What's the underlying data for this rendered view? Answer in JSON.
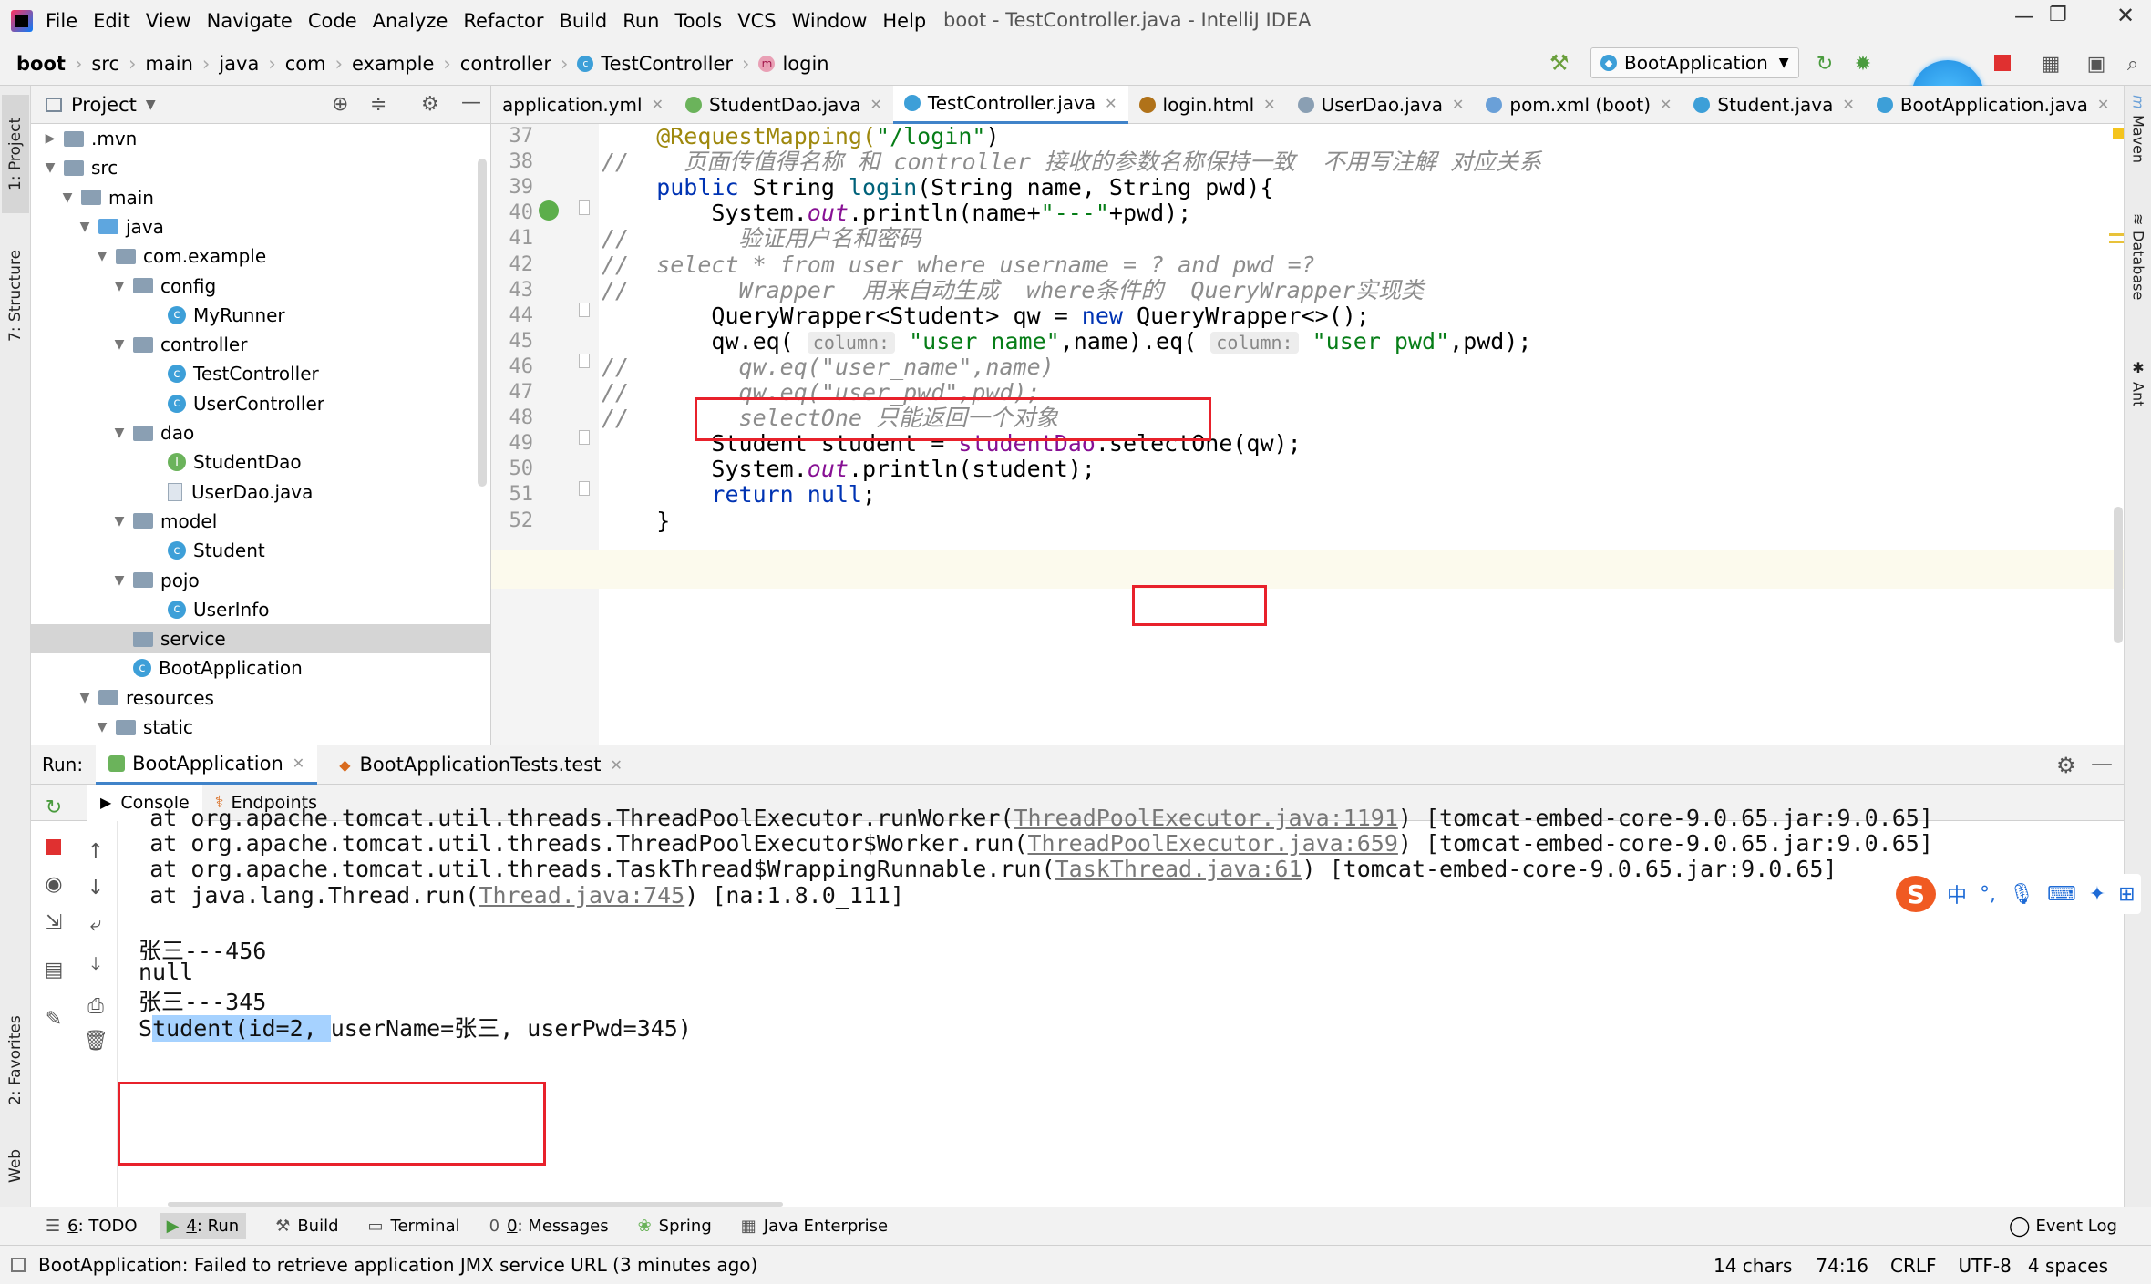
{
  "menubar": {
    "items": [
      "File",
      "Edit",
      "View",
      "Navigate",
      "Code",
      "Analyze",
      "Refactor",
      "Build",
      "Run",
      "Tools",
      "VCS",
      "Window",
      "Help"
    ],
    "window_title": "boot - TestController.java - IntelliJ IDEA"
  },
  "navbar": {
    "crumbs": [
      "boot",
      "src",
      "main",
      "java",
      "com",
      "example",
      "controller",
      "TestController",
      "login"
    ],
    "run_config": "BootApplication"
  },
  "project": {
    "title": "Project",
    "tree": [
      {
        "label": ".mvn",
        "arrow": "▶",
        "kind": "folder"
      },
      {
        "label": "src",
        "arrow": "▼",
        "kind": "folder"
      },
      {
        "label": "main",
        "arrow": "▼",
        "kind": "folder"
      },
      {
        "label": "java",
        "arrow": "▼",
        "kind": "folder-blue"
      },
      {
        "label": "com.example",
        "arrow": "▼",
        "kind": "folder"
      },
      {
        "label": "config",
        "arrow": "▼",
        "kind": "folder"
      },
      {
        "label": "MyRunner",
        "arrow": "",
        "kind": "class"
      },
      {
        "label": "controller",
        "arrow": "▼",
        "kind": "folder"
      },
      {
        "label": "TestController",
        "arrow": "",
        "kind": "class"
      },
      {
        "label": "UserController",
        "arrow": "",
        "kind": "class"
      },
      {
        "label": "dao",
        "arrow": "▼",
        "kind": "folder"
      },
      {
        "label": "StudentDao",
        "arrow": "",
        "kind": "interface"
      },
      {
        "label": "UserDao.java",
        "arrow": "",
        "kind": "file"
      },
      {
        "label": "model",
        "arrow": "▼",
        "kind": "folder"
      },
      {
        "label": "Student",
        "arrow": "",
        "kind": "class"
      },
      {
        "label": "pojo",
        "arrow": "▼",
        "kind": "folder"
      },
      {
        "label": "UserInfo",
        "arrow": "",
        "kind": "class"
      },
      {
        "label": "service",
        "arrow": "",
        "kind": "folder"
      },
      {
        "label": "BootApplication",
        "arrow": "",
        "kind": "class"
      },
      {
        "label": "resources",
        "arrow": "▼",
        "kind": "folder"
      },
      {
        "label": "static",
        "arrow": "▼",
        "kind": "folder"
      }
    ]
  },
  "tabs": [
    {
      "label": "application.yml",
      "icon": "yml-icon",
      "color": "#8a8a8a"
    },
    {
      "label": "StudentDao.java",
      "icon": "interface-icon",
      "color": "#6bb35b"
    },
    {
      "label": "TestController.java",
      "icon": "class-icon",
      "color": "#3d9fd8",
      "active": true
    },
    {
      "label": "login.html",
      "icon": "html-icon",
      "color": "#b07219"
    },
    {
      "label": "UserDao.java",
      "icon": "file-icon",
      "color": "#8a9fb3"
    },
    {
      "label": "pom.xml (boot)",
      "icon": "maven-icon",
      "color": "#6aa0d8"
    },
    {
      "label": "Student.java",
      "icon": "class-icon",
      "color": "#3d9fd8"
    },
    {
      "label": "BootApplication.java",
      "icon": "class-icon",
      "color": "#3d9fd8"
    }
  ],
  "editor": {
    "lines": [
      {
        "n": "37",
        "parts": [
          {
            "c": "ann",
            "t": "    @RequestMapping("
          },
          {
            "c": "str",
            "t": "\"/login\""
          },
          {
            "c": "",
            "t": ")"
          }
        ]
      },
      {
        "n": "38",
        "parts": [
          {
            "c": "cm",
            "t": "//    页面传值得名称 和 controller 接收的参数名称保持一致  不用写注解 对应关系"
          }
        ]
      },
      {
        "n": "39",
        "parts": [
          {
            "c": "kw",
            "t": "    public "
          },
          {
            "c": "",
            "t": "String "
          },
          {
            "c": "mth",
            "t": "login"
          },
          {
            "c": "",
            "t": "(String name, String pwd){"
          }
        ]
      },
      {
        "n": "40",
        "parts": [
          {
            "c": "",
            "t": "        System."
          },
          {
            "c": "fld",
            "t": "out"
          },
          {
            "c": "",
            "t": ".println(name+"
          },
          {
            "c": "str",
            "t": "\"---\""
          },
          {
            "c": "",
            "t": "+pwd);"
          }
        ]
      },
      {
        "n": "41",
        "parts": [
          {
            "c": "cm",
            "t": "//        验证用户名和密码"
          }
        ]
      },
      {
        "n": "42",
        "parts": [
          {
            "c": "cm",
            "t": "//  select * from user where username = ? and pwd =?"
          }
        ]
      },
      {
        "n": "43",
        "parts": [
          {
            "c": "cm",
            "t": "//        Wrapper  用来自动生成  where条件的  QueryWrapper实现类"
          }
        ]
      },
      {
        "n": "44",
        "parts": [
          {
            "c": "",
            "t": "        QueryWrapper<Student> qw = "
          },
          {
            "c": "kw",
            "t": "new "
          },
          {
            "c": "",
            "t": "QueryWrapper<>();"
          }
        ]
      },
      {
        "n": "45",
        "parts": [
          {
            "c": "",
            "t": "        qw.eq( "
          },
          {
            "c": "hint",
            "t": "column:"
          },
          {
            "c": "str",
            "t": " \"user_name\""
          },
          {
            "c": "",
            "t": ",name).eq( "
          },
          {
            "c": "hint",
            "t": "column:"
          },
          {
            "c": "str",
            "t": " \"user_pwd\""
          },
          {
            "c": "",
            "t": ",pwd);"
          }
        ]
      },
      {
        "n": "46",
        "parts": [
          {
            "c": "cm",
            "t": "//        qw.eq(\"user_name\",name)"
          }
        ]
      },
      {
        "n": "47",
        "parts": [
          {
            "c": "cm",
            "t": "//        qw.eq(\"user_pwd\",pwd);"
          }
        ]
      },
      {
        "n": "48",
        "parts": [
          {
            "c": "cm",
            "t": "//        selectOne 只能返回一个对象"
          }
        ]
      },
      {
        "n": "49",
        "parts": [
          {
            "c": "",
            "t": "        Student student = "
          },
          {
            "c": "fld2",
            "t": "studentDao"
          },
          {
            "c": "",
            "t": ".selectOne(qw);"
          }
        ]
      },
      {
        "n": "50",
        "parts": [
          {
            "c": "",
            "t": "        System."
          },
          {
            "c": "fld",
            "t": "out"
          },
          {
            "c": "",
            "t": ".println(student);"
          }
        ]
      },
      {
        "n": "51",
        "parts": [
          {
            "c": "kw",
            "t": "        return null"
          },
          {
            "c": "",
            "t": ";"
          }
        ]
      },
      {
        "n": "52",
        "parts": [
          {
            "c": "",
            "t": "    }"
          }
        ]
      }
    ]
  },
  "run": {
    "label": "Run:",
    "tabs": [
      "BootApplication",
      "BootApplicationTests.test"
    ],
    "subtabs": [
      "Console",
      "Endpoints"
    ]
  },
  "console": {
    "lines": [
      [
        {
          "t": "    at org.apache.tomcat.util.threads.ThreadPoolExecutor.runWorker("
        },
        {
          "l": "ThreadPoolExecutor.java:1191"
        },
        {
          "t": ") [tomcat-embed-core-9.0.65.jar:9.0.65]"
        }
      ],
      [
        {
          "t": "    at org.apache.tomcat.util.threads.ThreadPoolExecutor$Worker.run("
        },
        {
          "l": "ThreadPoolExecutor.java:659"
        },
        {
          "t": ") [tomcat-embed-core-9.0.65.jar:9.0.65]"
        }
      ],
      [
        {
          "t": "    at org.apache.tomcat.util.threads.TaskThread$WrappingRunnable.run("
        },
        {
          "l": "TaskThread.java:61"
        },
        {
          "t": ") [tomcat-embed-core-9.0.65.jar:9.0.65]"
        }
      ],
      [
        {
          "t": "    at java.lang.Thread.run("
        },
        {
          "l": "Thread.java:745"
        },
        {
          "t": ") [na:1.8.0_111]"
        }
      ],
      [
        {
          "t": ""
        }
      ],
      [
        {
          "t": "张三---456"
        }
      ],
      [
        {
          "t": "null"
        }
      ],
      [
        {
          "t": "张三---345"
        }
      ],
      [
        {
          "t": "S"
        },
        {
          "h": "tudent(id=2, "
        },
        {
          "t": "userName=张三, userPwd=345)"
        }
      ]
    ]
  },
  "toolwindows": [
    {
      "k": "6",
      "label": ": TODO"
    },
    {
      "k": "4",
      "label": ": Run"
    },
    {
      "k": "",
      "label": "Build"
    },
    {
      "k": "",
      "label": "Terminal"
    },
    {
      "k": "0",
      "label": ": Messages"
    },
    {
      "k": "",
      "label": "Spring"
    },
    {
      "k": "",
      "label": "Java Enterprise"
    }
  ],
  "event_log": "Event Log",
  "status": {
    "message": "BootApplication: Failed to retrieve application JMX service URL (3 minutes ago)",
    "chars": "14 chars",
    "pos": "74:16",
    "eol": "CRLF",
    "enc": "UTF-8",
    "indent": "4 spaces"
  },
  "left_tabs": [
    "1: Project",
    "7: Structure",
    "2: Favorites",
    "Web"
  ],
  "right_tabs": [
    "Maven",
    "Database",
    "Ant"
  ]
}
